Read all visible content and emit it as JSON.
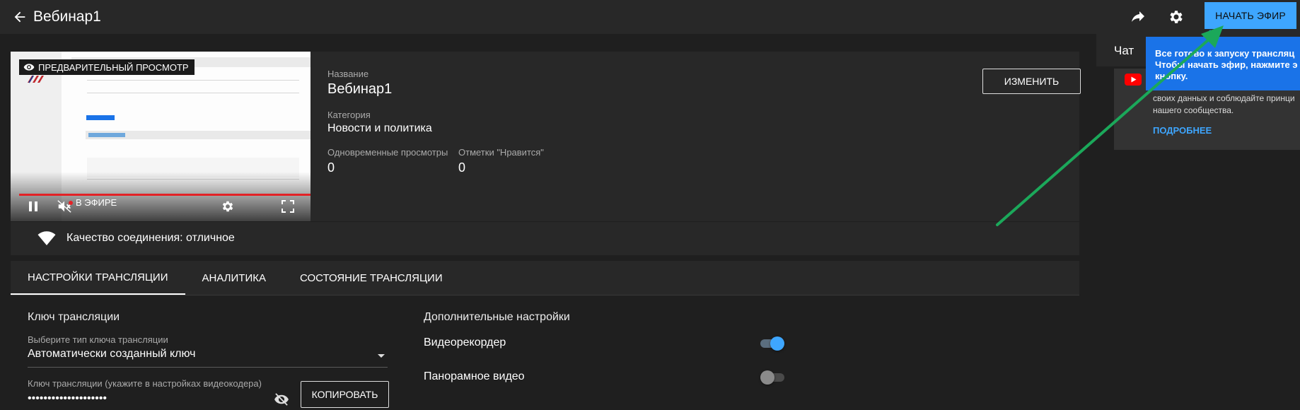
{
  "header": {
    "title": "Вебинар1",
    "start_button": "НАЧАТЬ ЭФИР"
  },
  "preview": {
    "badge": "ПРЕДВАРИТЕЛЬНЫЙ ПРОСМОТР",
    "live_label": "В ЭФИРЕ"
  },
  "details": {
    "name_label": "Название",
    "name_value": "Вебинар1",
    "category_label": "Категория",
    "category_value": "Новости и политика",
    "concurrent_label": "Одновременные просмотры",
    "concurrent_value": "0",
    "likes_label": "Отметки \"Нравится\"",
    "likes_value": "0",
    "edit_button": "ИЗМЕНИТЬ"
  },
  "connection": {
    "quality_text": "Качество соединения: отличное"
  },
  "tabs": [
    {
      "label": "НАСТРОЙКИ ТРАНСЛЯЦИИ",
      "active": true
    },
    {
      "label": "АНАЛИТИКА",
      "active": false
    },
    {
      "label": "СОСТОЯНИЕ ТРАНСЛЯЦИИ",
      "active": false
    }
  ],
  "stream_key": {
    "section_title": "Ключ трансляции",
    "type_label": "Выберите тип ключа трансляции",
    "type_value": "Автоматически созданный ключ",
    "key_label": "Ключ трансляции (укажите в настройках видеокодера)",
    "key_value": "••••••••••••••••••••",
    "copy_button": "КОПИРОВАТЬ"
  },
  "additional": {
    "section_title": "Дополнительные настройки",
    "options": [
      {
        "label": "Видеорекордер",
        "enabled": true
      },
      {
        "label": "Панорамное видео",
        "enabled": false
      }
    ]
  },
  "chat": {
    "title": "Чат",
    "card_lines": [
      "своих данных и соблюдайте принци",
      "нашего сообщества."
    ],
    "card_link": "ПОДРОБНЕЕ"
  },
  "tooltip": {
    "lines": [
      "Все готово к запуску трансляц",
      "Чтобы начать эфир, нажмите э",
      "кнопку."
    ]
  },
  "colors": {
    "accent": "#3ea6ff",
    "tooltip": "#1a73e8",
    "live_red": "#e32226",
    "annotation_arrow": "#1ba85a"
  }
}
